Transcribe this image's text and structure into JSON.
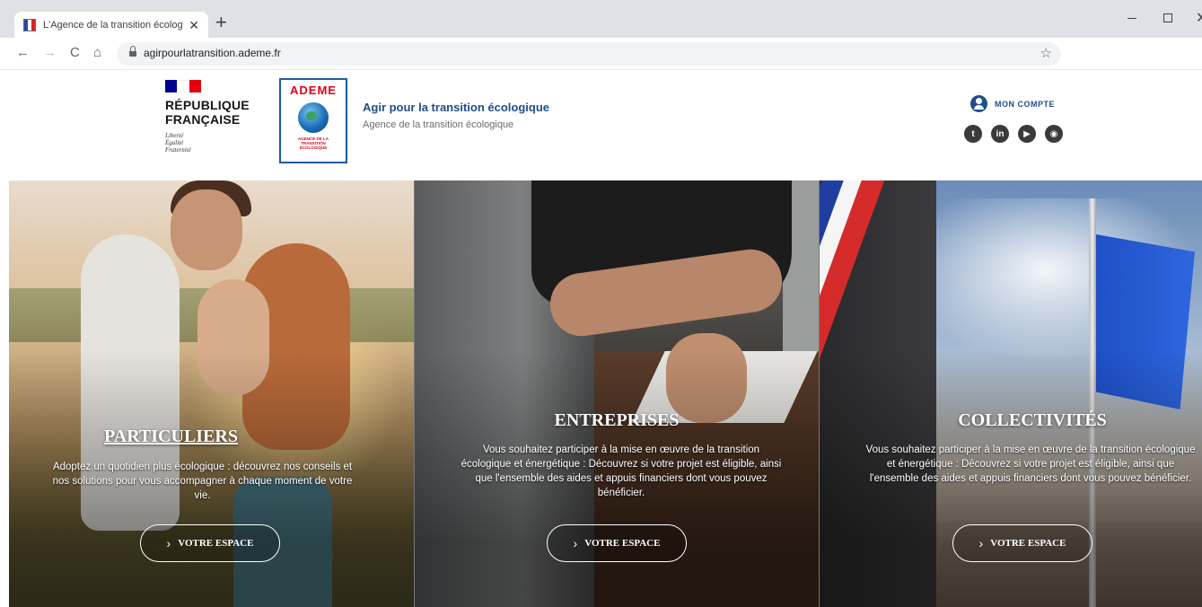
{
  "browser": {
    "tab_title": "L'Agence de la transition écologi",
    "tab_close": "✕",
    "new_tab": "+",
    "url": "agirpourlatransition.ademe.fr",
    "nav_back": "←",
    "nav_forward": "→",
    "nav_reload": "C",
    "nav_home": "⌂",
    "bookmark": "☆",
    "win_close": "✕"
  },
  "header": {
    "rf_lines": [
      "RÉPUBLIQUE",
      "FRANÇAISE"
    ],
    "rf_motto": [
      "Liberté",
      "Égalité",
      "Fraternité"
    ],
    "ademe_name": "ADEME",
    "ademe_tagline": "AGENCE DE LA TRANSITION ÉCOLOGIQUE",
    "site_title": "Agir pour la transition écologique",
    "site_subtitle": "Agence de la transition écologique",
    "account_label": "MON COMPTE",
    "socials": [
      {
        "icon": "twitter-icon",
        "glyph": "t"
      },
      {
        "icon": "linkedin-icon",
        "glyph": "in"
      },
      {
        "icon": "youtube-icon",
        "glyph": "▶"
      },
      {
        "icon": "rss-icon",
        "glyph": "◉"
      }
    ],
    "colors": {
      "brand_blue": "#1f4e8c",
      "ademe_red": "#e2001a"
    }
  },
  "panels": [
    {
      "title": "PARTICULIERS",
      "text": "Adoptez un quotidien plus écologique : découvrez nos conseils et nos solutions pour vous accompagner à chaque moment de votre vie.",
      "button_label": "VOTRE ESPACE",
      "chevron": "›"
    },
    {
      "title": "ENTREPRISES",
      "text": "Vous souhaitez participer à la mise en œuvre de la transition écologique et énergétique : Découvrez si votre projet est éligible, ainsi que l'ensemble des aides et appuis financiers dont vous pouvez bénéficier.",
      "button_label": "VOTRE ESPACE",
      "chevron": "›"
    },
    {
      "title": "COLLECTIVITÉS",
      "text": "Vous souhaitez participer à la mise en œuvre de la transition écologique et énergétique : Découvrez si votre projet est éligible, ainsi que l'ensemble des aides et appuis financiers dont vous pouvez bénéficier.",
      "button_label": "VOTRE ESPACE",
      "chevron": "›"
    }
  ]
}
